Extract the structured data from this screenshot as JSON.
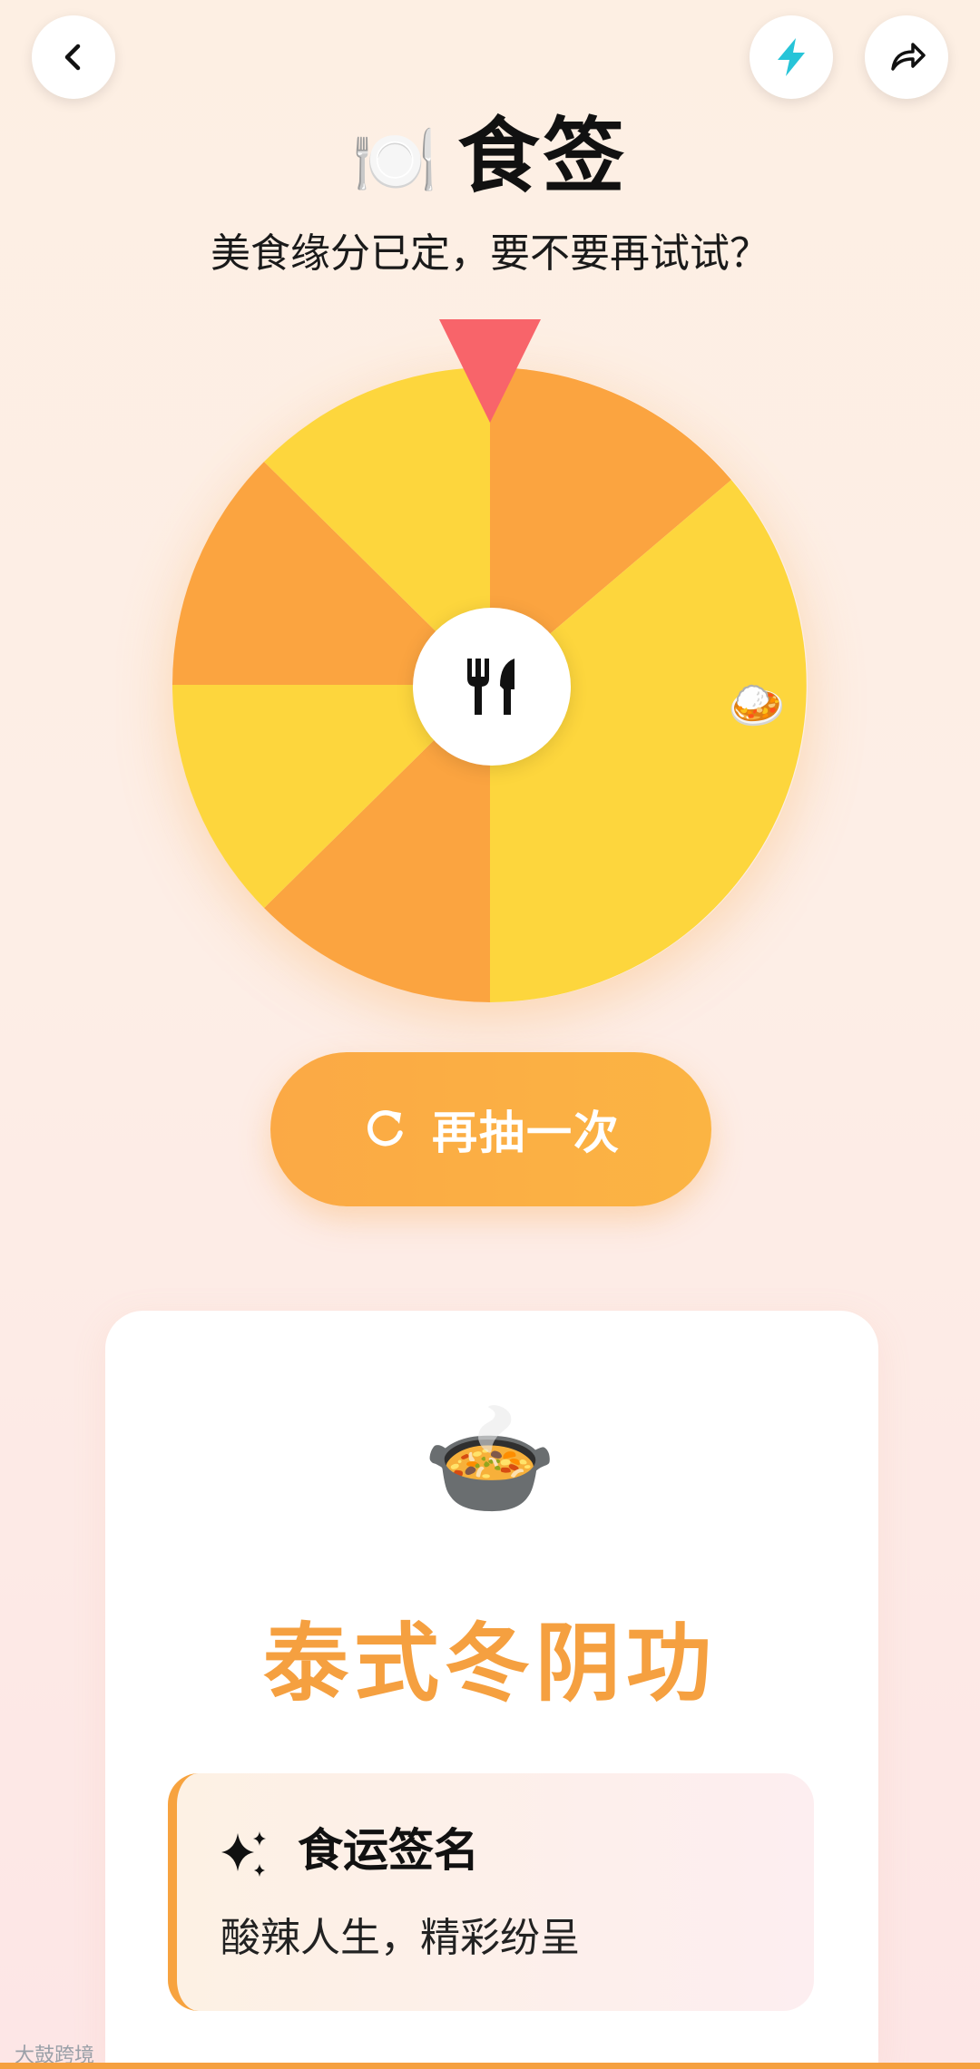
{
  "header": {
    "back_icon": "chevron-left-icon",
    "flash_icon": "lightning-icon",
    "share_icon": "share-arrow-icon",
    "title_emoji": "🍽️",
    "title": "食签",
    "subtitle": "美食缘分已定，要不要再试试？"
  },
  "wheel": {
    "hub_icon": "fork-knife-icon",
    "pointer_icon": "pointer-triangle-icon",
    "segments": [
      {
        "color": "#fba440"
      },
      {
        "color": "#fdd63d"
      },
      {
        "color": "#fdd63d"
      },
      {
        "color": "#fba440"
      },
      {
        "color": "#fdd63d"
      },
      {
        "color": "#fba440"
      },
      {
        "color": "#fdd63d"
      }
    ],
    "visible_segment_emoji": "🍛"
  },
  "respin": {
    "icon": "refresh-icon",
    "label": "再抽一次"
  },
  "result": {
    "emoji": "🍲",
    "name": "泰式冬阴功",
    "fortune_icon": "sparkles-icon",
    "fortune_title": "食运签名",
    "fortune_text": "酸辣人生，精彩纷呈"
  },
  "watermark": "大鼓跨境",
  "colors": {
    "accent": "#f5a040",
    "pointer": "#f8646a",
    "flash": "#27c4d8"
  }
}
